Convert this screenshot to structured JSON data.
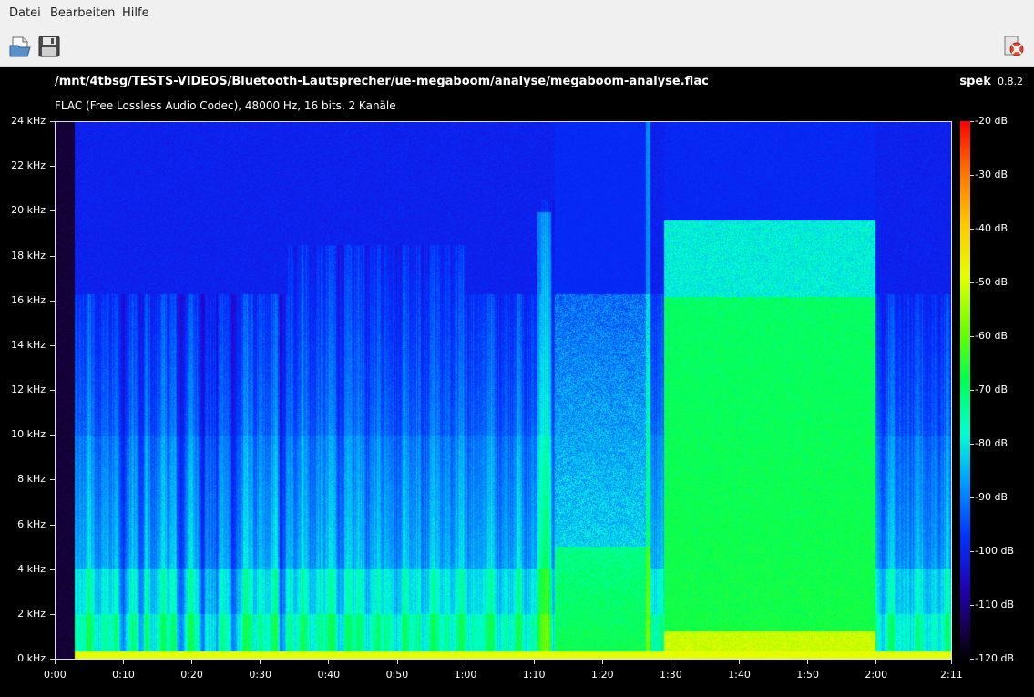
{
  "menubar": {
    "items": [
      "Datei",
      "Bearbeiten",
      "Hilfe"
    ]
  },
  "toolbar": {
    "open_icon": "open-file-icon",
    "save_icon": "save-icon",
    "help_icon": "help-lifebuoy-icon"
  },
  "header": {
    "file_path": "/mnt/4tbsg/TESTS-VIDEOS/Bluetooth-Lautsprecher/ue-megaboom/analyse/megaboom-analyse.flac",
    "app_name": "spek",
    "app_version": "0.8.2",
    "codec_info": "FLAC (Free Lossless Audio Codec), 48000 Hz, 16 bits, 2 Kanäle"
  },
  "spectrogram": {
    "y_axis_labels": [
      "24 kHz",
      "22 kHz",
      "20 kHz",
      "18 kHz",
      "16 kHz",
      "14 kHz",
      "12 kHz",
      "10 kHz",
      "8 kHz",
      "6 kHz",
      "4 kHz",
      "2 kHz",
      "0 kHz"
    ],
    "x_axis_labels": [
      "0:00",
      "0:10",
      "0:20",
      "0:30",
      "0:40",
      "0:50",
      "1:00",
      "1:10",
      "1:20",
      "1:30",
      "1:40",
      "1:50",
      "2:00",
      "2:11"
    ],
    "x_axis_seconds": [
      0,
      10,
      20,
      30,
      40,
      50,
      60,
      70,
      80,
      90,
      100,
      110,
      120,
      131
    ],
    "duration_seconds": 131,
    "freq_max_khz": 24,
    "colorbar_labels": [
      "-20 dB",
      "-30 dB",
      "-40 dB",
      "-50 dB",
      "-60 dB",
      "-70 dB",
      "-80 dB",
      "-90 dB",
      "-100 dB",
      "-110 dB",
      "-120 dB"
    ]
  }
}
